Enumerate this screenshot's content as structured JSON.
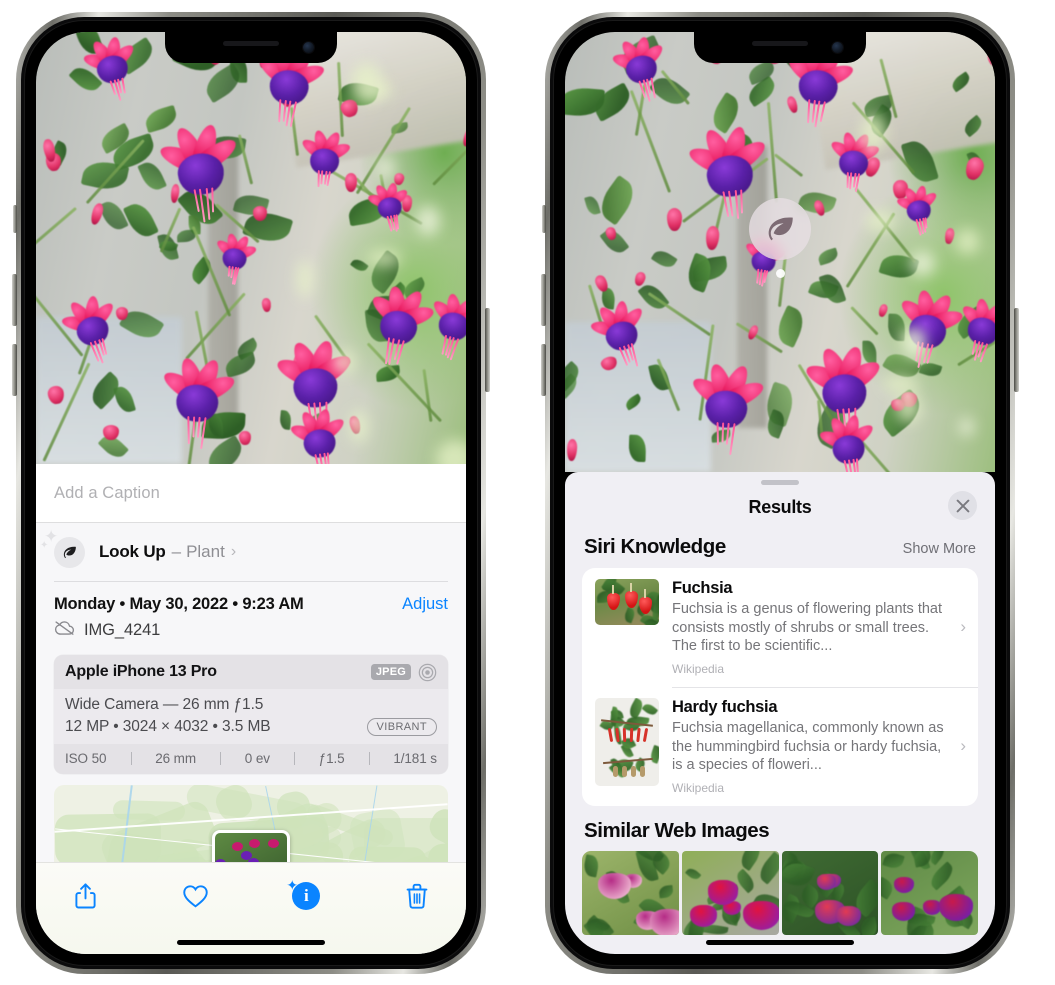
{
  "left_phone": {
    "caption": {
      "placeholder": "Add a Caption",
      "value": ""
    },
    "lookup": {
      "icon": "leaf-icon",
      "title": "Look Up",
      "dash": "–",
      "subject": "Plant",
      "chevron": "›"
    },
    "date": {
      "text": "Monday • May 30, 2022 • 9:23 AM",
      "adjust_label": "Adjust"
    },
    "file": {
      "icon": "cloud-slash-icon",
      "name": "IMG_4241"
    },
    "exif": {
      "device": "Apple iPhone 13 Pro",
      "format_tag": "JPEG",
      "hdr_icon": "hdr-circle-icon",
      "lens_line": "Wide Camera — 26 mm ƒ1.5",
      "size_line": "12 MP • 3024 × 4032 • 3.5 MB",
      "style_pill": "VIBRANT",
      "stats": [
        "ISO 50",
        "26 mm",
        "0 ev",
        "ƒ1.5",
        "1/181 s"
      ]
    },
    "map": {
      "pin_label": "photo-thumbnail-pin"
    },
    "toolbar": [
      {
        "name": "share-button",
        "icon": "share-icon"
      },
      {
        "name": "favorite-button",
        "icon": "heart-icon"
      },
      {
        "name": "info-button",
        "icon": "info-sparkle-icon",
        "glyph": "i"
      },
      {
        "name": "delete-button",
        "icon": "trash-icon"
      }
    ],
    "accent": "#0a84ff"
  },
  "right_phone": {
    "visual_lookup_badge": {
      "icon": "leaf-icon",
      "name": "visual-look-up-badge"
    },
    "sheet": {
      "title": "Results",
      "close_icon": "close-icon"
    },
    "siri_knowledge": {
      "title": "Siri Knowledge",
      "show_more": "Show More",
      "items": [
        {
          "name": "Fuchsia",
          "description": "Fuchsia is a genus of flowering plants that consists mostly of shrubs or small trees. The first to be scientific...",
          "source": "Wikipedia",
          "thumb": "fuchsia-red-flowers-thumbnail"
        },
        {
          "name": "Hardy fuchsia",
          "description": "Fuchsia magellanica, commonly known as the hummingbird fuchsia or hardy fuchsia, is a species of floweri...",
          "source": "Wikipedia",
          "thumb": "hardy-fuchsia-herbarium-thumbnail"
        }
      ]
    },
    "similar_web_images": {
      "title": "Similar Web Images",
      "items": [
        "pink-white-fuchsia-with-leaves",
        "red-magenta-fuchsia-closeup",
        "fuchsia-bush-red-blooms",
        "purple-red-fuchsia-cluster"
      ]
    }
  }
}
